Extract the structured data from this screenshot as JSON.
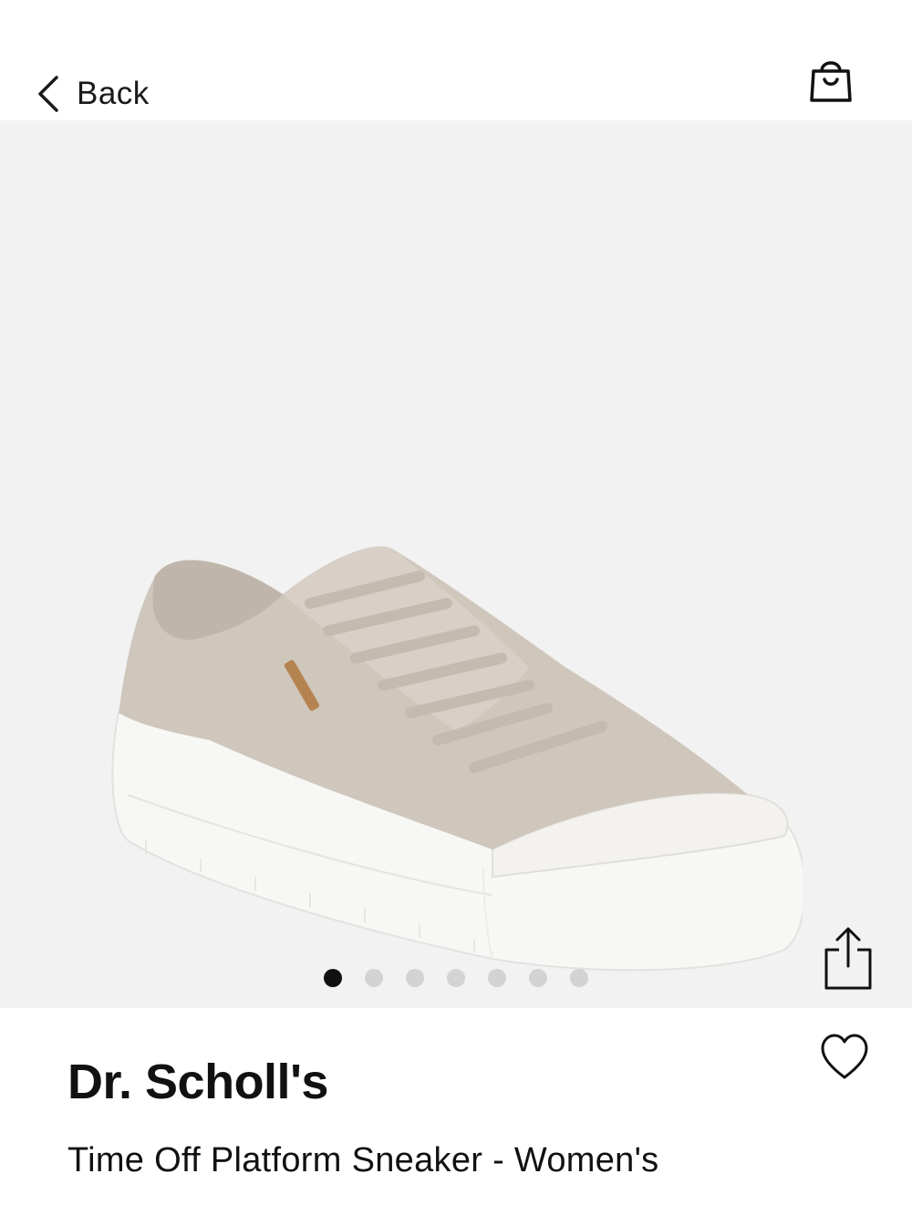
{
  "header": {
    "back_label": "Back",
    "back_icon": "chevron-left-icon",
    "cart_icon": "shopping-bag-icon"
  },
  "gallery": {
    "image": "sneaker-product-photo",
    "slide_count": 7,
    "active_slide": 1,
    "share_icon": "share-icon"
  },
  "product": {
    "brand": "Dr. Scholl's",
    "name": "Time Off Platform Sneaker - Women's",
    "favorite_icon": "heart-icon"
  },
  "colors": {
    "hero_background": "#f2f2f2",
    "active_dot": "#111111",
    "inactive_dot": "#d3d3d3",
    "shoe_upper": "#cfc6bc",
    "shoe_sole": "#f7f7f5"
  }
}
